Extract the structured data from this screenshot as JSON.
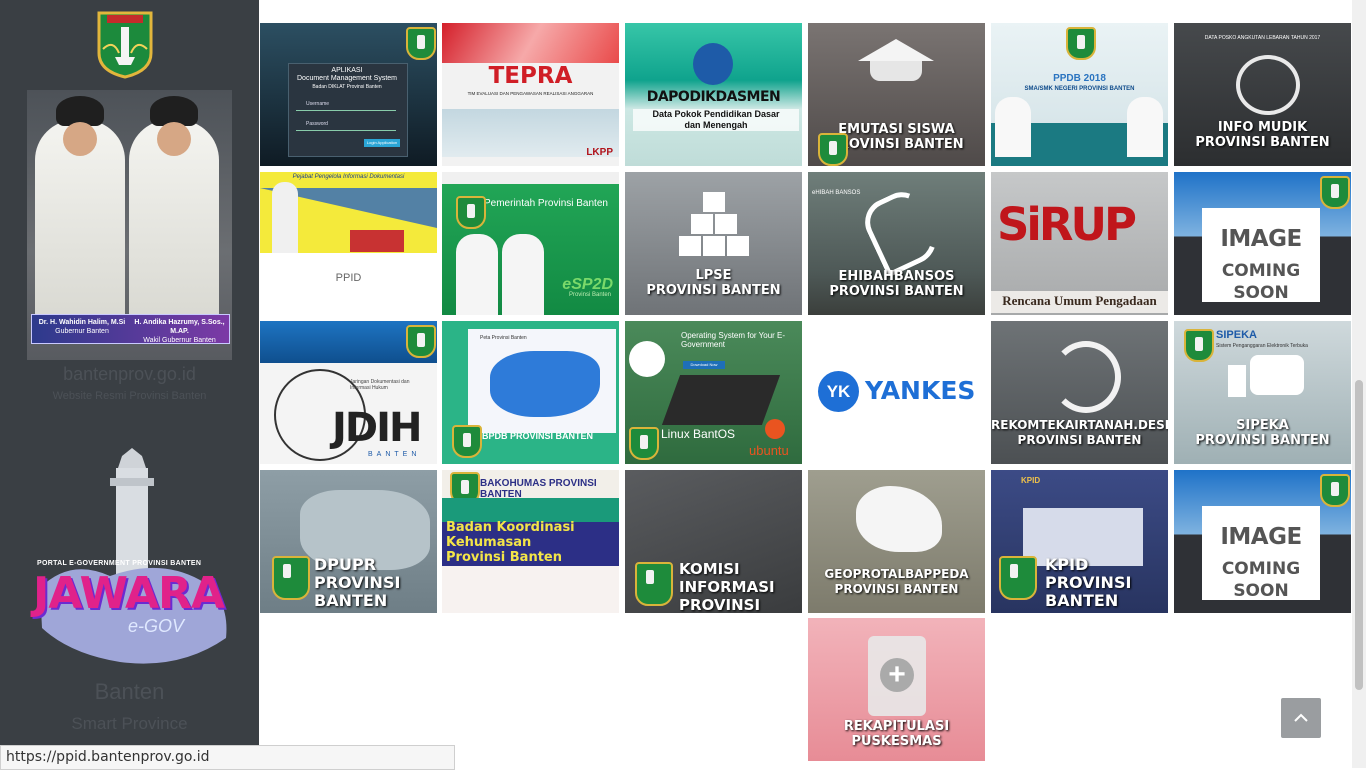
{
  "sidebar": {
    "governor_caption": "Dr. H. Wahidin Halim, M.Si\nGubernur Banten",
    "governor_name": "Dr. H. Wahidin Halim, M.Si",
    "governor_role": "Gubernur Banten",
    "vice_name": "H. Andika Hazrumy, S.Sos., M.AP.",
    "vice_role": "Wakil Gubernur Banten",
    "site": "bantenprov.go.id",
    "site_sub": "Website Resmi Provinsi Banten",
    "portal_sub": "PORTAL E-GOVERNMENT PROVINSI BANTEN",
    "portal_word": "JAWARA",
    "portal_egov": "e-GOV",
    "brand": "Banten",
    "brand_sub": "Smart Province"
  },
  "tiles": [
    {
      "title": "APLIKASI",
      "sub": "Document Management System",
      "sub2": "Badan DIKLAT Provinsi Banten",
      "f1": "Username",
      "f2": "Password",
      "btn": "Login Application"
    },
    {
      "title": "TEPRA",
      "sub": "TIM EVALUASI DAN PENGAWASAN REALISASI ANGGARAN",
      "logo": "LKPP"
    },
    {
      "title": "DAPODIKDASMEN",
      "sub": "Data Pokok Pendidikan Dasar",
      "sub2": "dan Menengah"
    },
    {
      "l1": "EMUTASI SISWA",
      "l2": "PROVINSI BANTEN"
    },
    {
      "l1": "PPDB 2018",
      "l2": "SMA/SMK NEGERI PROVINSI BANTEN"
    },
    {
      "top": "DATA POSKO ANGKUTAN LEBARAN TAHUN 2017",
      "l1": "INFO MUDIK",
      "l2": "PROVINSI BANTEN"
    },
    {
      "top": "Pejabat Pengelola Informasi Dokumentasi",
      "l1": "PPID"
    },
    {
      "top": "Pemerintah Provinsi Banten",
      "l1": "eSP2D",
      "l2": "Provinsi Banten"
    },
    {
      "l1": "LPSE",
      "l2": "PROVINSI BANTEN"
    },
    {
      "top": "eHIBAH BANSOS",
      "l1": "EHIBAHBANSOS",
      "l2": "PROVINSI BANTEN"
    },
    {
      "l1": "SiRUP",
      "l2": "Rencana Umum Pengadaan"
    },
    {
      "l1": "IMAGE",
      "l2": "COMING SOON"
    },
    {
      "top": "Jaringan Dokumentasi dan Informasi Hukum",
      "l1": "JDIH",
      "l2": "BANTEN"
    },
    {
      "top": "Peta Provinsi Banten",
      "l1": "BPDB PROVINSI BANTEN"
    },
    {
      "top": "Operating System for Your E-Government",
      "btn": "Download Now",
      "l1": "Linux BantOS",
      "l2": "ubuntu"
    },
    {
      "logo": "YK",
      "l1": "YANKES"
    },
    {
      "l1": "REKOMTEKAIRTANAH.DESDM",
      "l2": "PROVINSI BANTEN"
    },
    {
      "top": "SIPEKA",
      "sub": "Sistem Penganggaran Elektronik Terbuka",
      "l1": "SIPEKA",
      "l2": "PROVINSI BANTEN"
    },
    {
      "l1": "DPUPR",
      "l2": "PROVINSI BANTEN"
    },
    {
      "top": "BAKOHUMAS PROVINSI BANTEN",
      "l1": "Badan Koordinasi Kehumasan",
      "l2": "Provinsi Banten"
    },
    {
      "l1": "KOMISI INFORMASI",
      "l2": "PROVINSI BANTEN"
    },
    {
      "l1": "GEOPROTALBAPPEDA",
      "l2": "PROVINSI BANTEN"
    },
    {
      "top": "KPID",
      "l1": "KPID",
      "l2": "PROVINSI BANTEN"
    },
    {
      "l1": "IMAGE",
      "l2": "COMING SOON"
    },
    {
      "l1": "REKAPITULASI",
      "l2": "PUSKESMAS"
    }
  ],
  "back_to_top_icon": "chevron-up-icon",
  "status_url": "https://ppid.bantenprov.go.id",
  "colors": {
    "sidebar": "#3a3f44",
    "jawara_pink": "#e0228a",
    "badge_green": "#1e8b3b"
  }
}
